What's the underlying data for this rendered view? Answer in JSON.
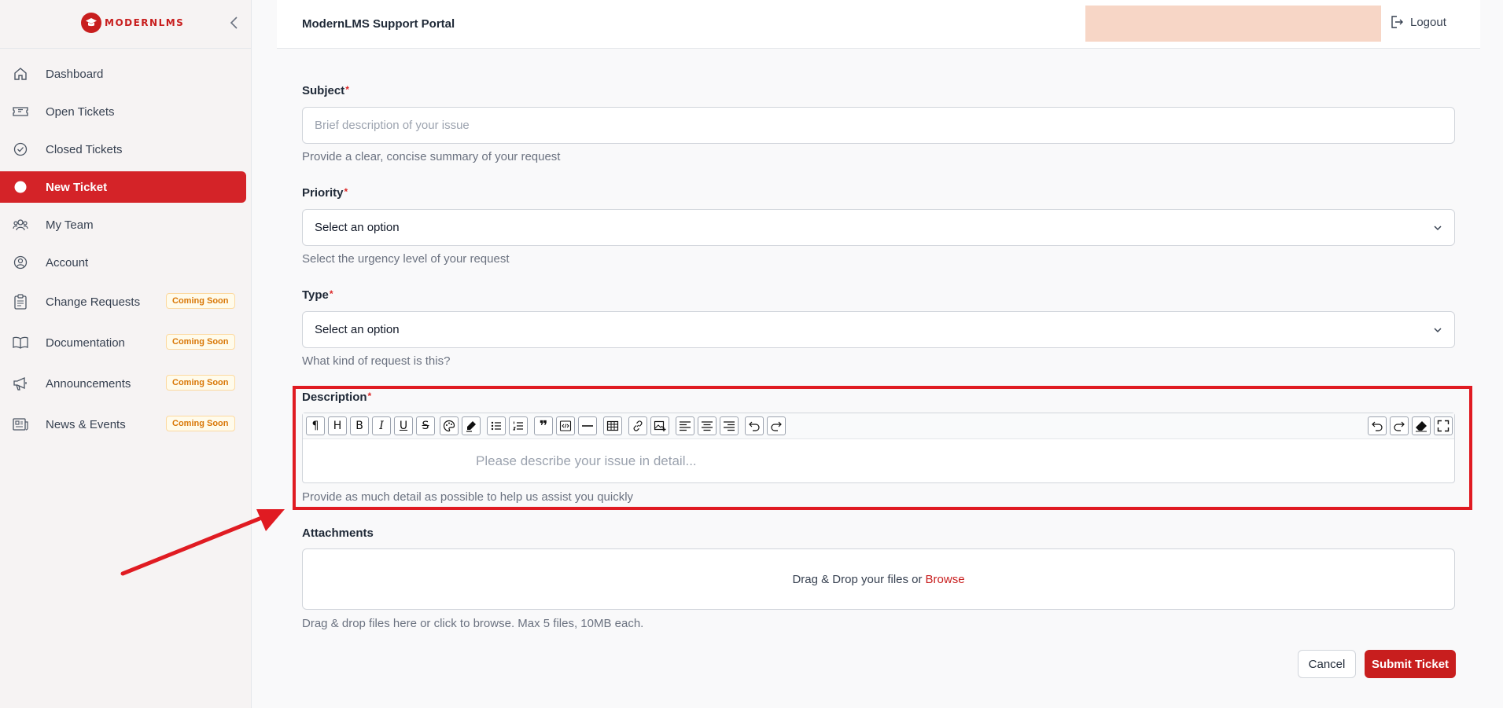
{
  "brand": {
    "name": "MODERNLMS",
    "color": "#c81e1e"
  },
  "header": {
    "title": "ModernLMS Support Portal",
    "logout_label": "Logout"
  },
  "sidebar": {
    "items": [
      {
        "label": "Dashboard",
        "icon": "home-icon"
      },
      {
        "label": "Open Tickets",
        "icon": "ticket-icon"
      },
      {
        "label": "Closed Tickets",
        "icon": "check-circle-icon"
      },
      {
        "label": "New Ticket",
        "icon": "dot-icon",
        "active": true
      },
      {
        "label": "My Team",
        "icon": "team-icon"
      },
      {
        "label": "Account",
        "icon": "user-circle-icon"
      },
      {
        "label": "Change Requests",
        "icon": "clipboard-icon",
        "badge": "Coming Soon"
      },
      {
        "label": "Documentation",
        "icon": "book-icon",
        "badge": "Coming Soon"
      },
      {
        "label": "Announcements",
        "icon": "megaphone-icon",
        "badge": "Coming Soon"
      },
      {
        "label": "News & Events",
        "icon": "newspaper-icon",
        "badge": "Coming Soon"
      }
    ]
  },
  "form": {
    "required_mark": "*",
    "subject": {
      "label": "Subject",
      "placeholder": "Brief description of your issue",
      "help": "Provide a clear, concise summary of your request"
    },
    "priority": {
      "label": "Priority",
      "value": "Select an option",
      "help": "Select the urgency level of your request"
    },
    "type": {
      "label": "Type",
      "value": "Select an option",
      "help": "What kind of request is this?"
    },
    "description": {
      "label": "Description",
      "placeholder": "Please describe your issue in detail...",
      "help": "Provide as much detail as possible to help us assist you quickly",
      "toolbar": [
        "paragraph",
        "heading",
        "bold",
        "italic",
        "underline",
        "strikethrough",
        "text-color",
        "highlight",
        "bullet-list",
        "numbered-list",
        "quote",
        "code-block",
        "horizontal-rule",
        "table",
        "link",
        "image",
        "align-left",
        "align-center",
        "align-right",
        "undo",
        "redo"
      ],
      "toolbar_right": [
        "undo",
        "redo",
        "clear-format",
        "fullscreen"
      ]
    },
    "attachments": {
      "label": "Attachments",
      "drop_text": "Drag & Drop your files or",
      "browse_label": "Browse",
      "help": "Drag & drop files here or click to browse. Max 5 files, 10MB each."
    },
    "cancel_label": "Cancel",
    "submit_label": "Submit Ticket"
  },
  "annotation": {
    "highlight_color": "#e01b22"
  }
}
